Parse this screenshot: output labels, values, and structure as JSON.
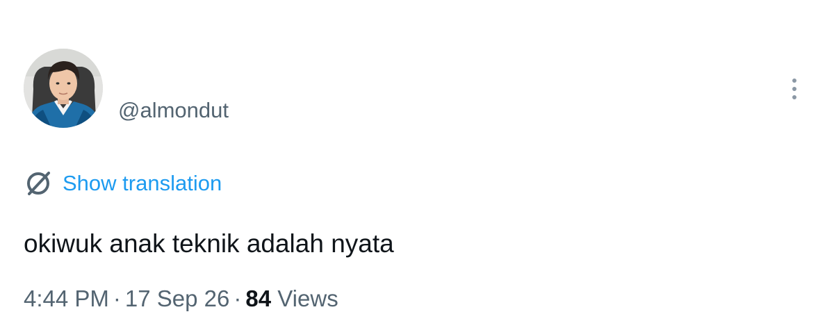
{
  "tweet": {
    "author": {
      "display_name": "",
      "handle": "@almondut",
      "avatar": "profile-photo"
    },
    "more_icon": "more-vertical-icon",
    "translation": {
      "icon": "globe-slash-icon",
      "label": "Show translation"
    },
    "text": "okiwuk anak teknik adalah nyata",
    "meta": {
      "time": "4:44 PM",
      "separator": "·",
      "date": "17 Sep 26",
      "views_count": "84",
      "views_label": "Views"
    }
  },
  "colors": {
    "text_primary": "#0f1419",
    "text_secondary": "#536471",
    "link": "#1d9bf0"
  }
}
